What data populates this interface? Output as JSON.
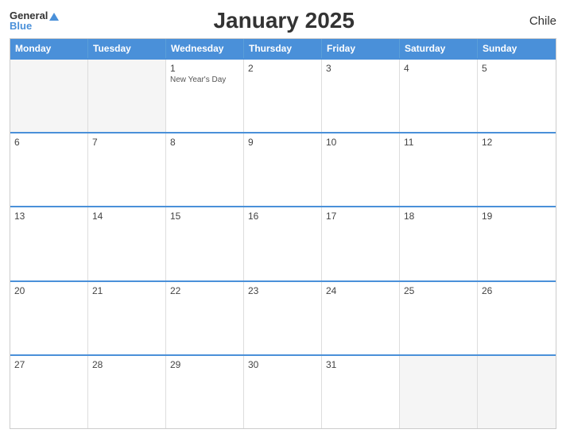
{
  "header": {
    "logo_general": "General",
    "logo_blue": "Blue",
    "title": "January 2025",
    "country": "Chile"
  },
  "days": [
    "Monday",
    "Tuesday",
    "Wednesday",
    "Thursday",
    "Friday",
    "Saturday",
    "Sunday"
  ],
  "weeks": [
    [
      {
        "num": "",
        "empty": true
      },
      {
        "num": "",
        "empty": true
      },
      {
        "num": "1",
        "event": "New Year's Day"
      },
      {
        "num": "2"
      },
      {
        "num": "3"
      },
      {
        "num": "4"
      },
      {
        "num": "5"
      }
    ],
    [
      {
        "num": "6"
      },
      {
        "num": "7"
      },
      {
        "num": "8"
      },
      {
        "num": "9"
      },
      {
        "num": "10"
      },
      {
        "num": "11"
      },
      {
        "num": "12"
      }
    ],
    [
      {
        "num": "13"
      },
      {
        "num": "14"
      },
      {
        "num": "15"
      },
      {
        "num": "16"
      },
      {
        "num": "17"
      },
      {
        "num": "18"
      },
      {
        "num": "19"
      }
    ],
    [
      {
        "num": "20"
      },
      {
        "num": "21"
      },
      {
        "num": "22"
      },
      {
        "num": "23"
      },
      {
        "num": "24"
      },
      {
        "num": "25"
      },
      {
        "num": "26"
      }
    ],
    [
      {
        "num": "27"
      },
      {
        "num": "28"
      },
      {
        "num": "29"
      },
      {
        "num": "30"
      },
      {
        "num": "31"
      },
      {
        "num": "",
        "empty": true
      },
      {
        "num": "",
        "empty": true
      }
    ]
  ]
}
